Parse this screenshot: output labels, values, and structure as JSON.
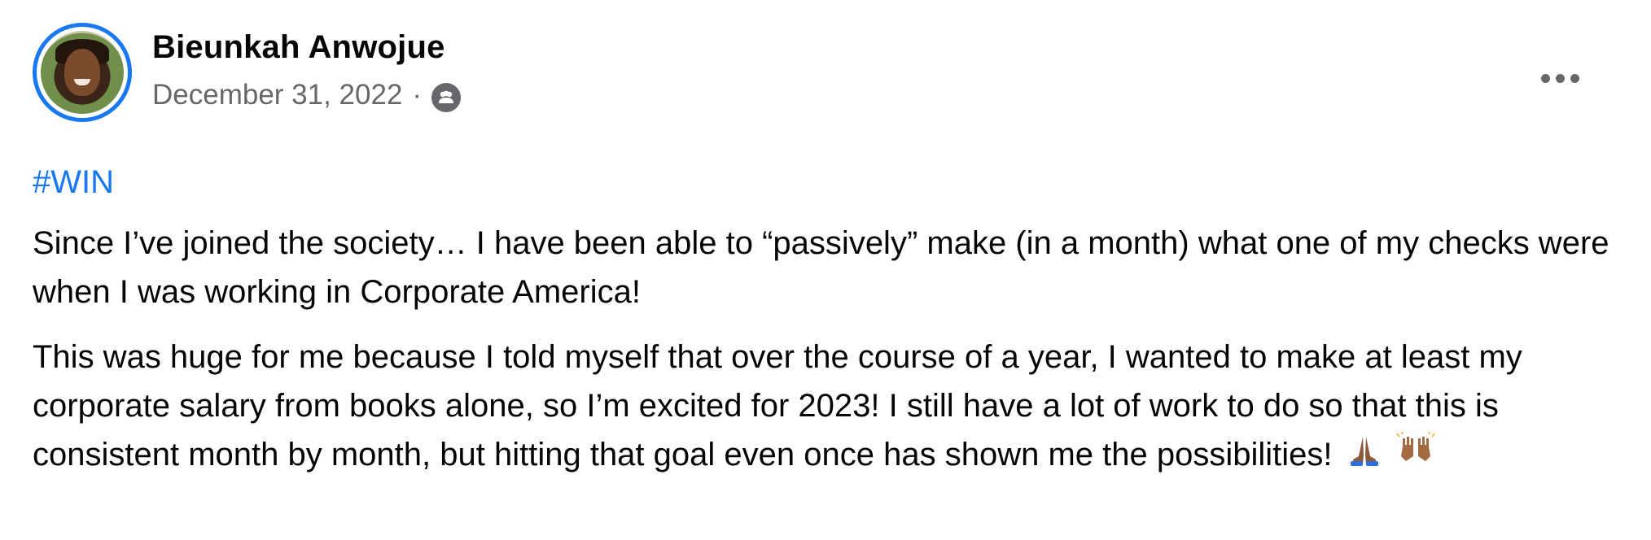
{
  "post": {
    "author_name": "Bieunkah Anwojue",
    "date": "December 31, 2022",
    "separator": "·",
    "audience_icon": "group-icon",
    "more_icon": "more-options-icon",
    "hashtag": "#WIN",
    "paragraphs": [
      "Since I’ve joined the society… I have been able to “passively” make (in a month) what one of my checks were when I was working in Corporate America!",
      "This was huge for me because I told myself that over the course of a year, I wanted to make at least my corporate salary from books alone, so I’m excited for 2023! I still have a lot of work to do so that this is consistent month by month, but hitting that goal even once has shown me the possibilities!"
    ],
    "emojis": [
      "folded-hands-emoji",
      "raising-hands-emoji"
    ]
  },
  "colors": {
    "accent": "#1877f2",
    "text": "#050505",
    "secondary": "#65676b",
    "background": "#ffffff"
  }
}
